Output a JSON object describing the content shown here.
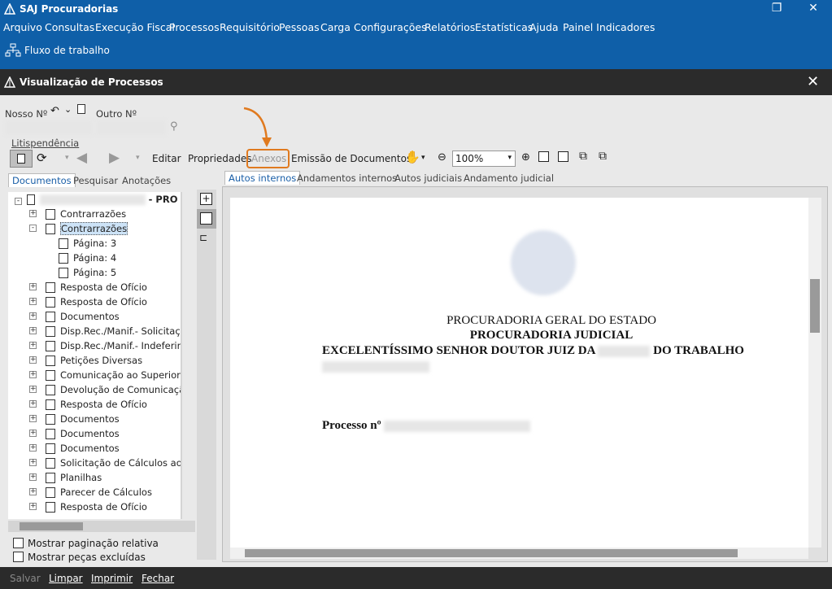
{
  "app": {
    "title": "SAJ Procuradorias"
  },
  "menu": [
    "Arquivo",
    "Consultas",
    "Execução Fiscal",
    "Processos",
    "Requisitório",
    "Pessoas",
    "Carga",
    "Configurações",
    "Relatórios",
    "Estatísticas",
    "Ajuda",
    "Painel Indicadores"
  ],
  "workflow_label": "Fluxo de trabalho",
  "window": {
    "title": "Visualização de Processos"
  },
  "fields": {
    "nosso_label": "Nosso Nº",
    "outro_label": "Outro Nº"
  },
  "litis_link": "Litispendência",
  "toolbar": {
    "editar": "Editar",
    "propriedades": "Propriedades",
    "anexos": "Anexos",
    "emissao": "Emissão de Documentos",
    "zoom": "100%"
  },
  "left_tabs": [
    "Documentos",
    "Pesquisar",
    "Anotações"
  ],
  "tree": {
    "root_suffix": "- PRO",
    "items": [
      {
        "label": "Contrarrazões",
        "level": 1,
        "exp": "+"
      },
      {
        "label": "Contrarrazões",
        "level": 1,
        "exp": "-",
        "selected": true
      },
      {
        "label": "Página: 3",
        "level": 2
      },
      {
        "label": "Página: 4",
        "level": 2
      },
      {
        "label": "Página: 5",
        "level": 2
      },
      {
        "label": "Resposta de Ofício",
        "level": 1,
        "exp": "+"
      },
      {
        "label": "Resposta de Ofício",
        "level": 1,
        "exp": "+"
      },
      {
        "label": "Documentos",
        "level": 1,
        "exp": "+"
      },
      {
        "label": "Disp.Rec./Manif.- Solicitação",
        "level": 1,
        "exp": "+"
      },
      {
        "label": "Disp.Rec./Manif.- Indeferiment",
        "level": 1,
        "exp": "+"
      },
      {
        "label": "Petições Diversas",
        "level": 1,
        "exp": "+"
      },
      {
        "label": "Comunicação ao Superior",
        "level": 1,
        "exp": "+"
      },
      {
        "label": "Devolução de Comunicação a",
        "level": 1,
        "exp": "+"
      },
      {
        "label": "Resposta de Ofício",
        "level": 1,
        "exp": "+"
      },
      {
        "label": "Documentos",
        "level": 1,
        "exp": "+"
      },
      {
        "label": "Documentos",
        "level": 1,
        "exp": "+"
      },
      {
        "label": "Documentos",
        "level": 1,
        "exp": "+"
      },
      {
        "label": "Solicitação de Cálculos ao Co",
        "level": 1,
        "exp": "+"
      },
      {
        "label": "Planilhas",
        "level": 1,
        "exp": "+"
      },
      {
        "label": "Parecer de Cálculos",
        "level": 1,
        "exp": "+"
      },
      {
        "label": "Resposta de Ofício",
        "level": 1,
        "exp": "+"
      }
    ]
  },
  "checks": {
    "paginacao": "Mostrar paginação relativa",
    "excluidas": "Mostrar peças excluídas"
  },
  "right_tabs": [
    "Autos internos",
    "Andamentos internos",
    "Autos judiciais",
    "Andamento judicial"
  ],
  "document": {
    "line1": "PROCURADORIA GERAL DO ESTADO",
    "line2": "PROCURADORIA JUDICIAL",
    "line3a": "EXCELENTÍSSIMO SENHOR DOUTOR JUIZ DA",
    "line3b": "DO TRABALHO",
    "processo": "Processo nº"
  },
  "status": {
    "salvar": "Salvar",
    "limpar": "Limpar",
    "imprimir": "Imprimir",
    "fechar": "Fechar"
  },
  "colors": {
    "accent": "#0f5fa8",
    "highlight": "#e07a1f"
  }
}
